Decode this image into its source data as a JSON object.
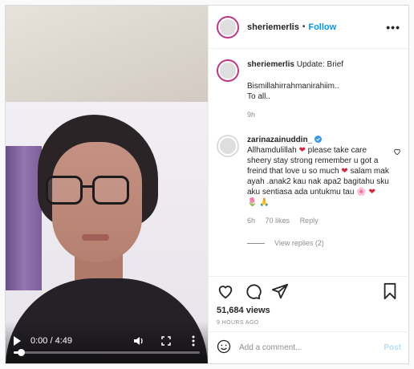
{
  "video": {
    "time": "0:00 / 4:49",
    "progress": 0.04
  },
  "header": {
    "username": "sheriemerlis",
    "separator": "•",
    "follow": "Follow",
    "more": "•••"
  },
  "caption": {
    "username": "sheriemerlis",
    "text": "Update: Brief",
    "line2": "Bismillahirrahmanirahiim..",
    "line3": "To all..",
    "time": "9h"
  },
  "comment": {
    "username": "zarinazainuddin_",
    "verified": true,
    "text_part1": "Allhamdulillah",
    "text_part2": "please take care sheery stay strong remember u got a freind that love u so much",
    "text_part3": "salam mak ayah .anak2 kau nak apa2 bagitahu sku aku sentiasa ada untukmu tau",
    "emoji_line": "🌷 🙏",
    "time": "6h",
    "likes": "70 likes",
    "reply": "Reply",
    "view_replies": "View replies (2)"
  },
  "stats": {
    "views": "51,684 views",
    "ago": "9 HOURS AGO"
  },
  "add_comment": {
    "placeholder": "Add a comment...",
    "post": "Post"
  },
  "colors": {
    "accent": "#0095f6",
    "post_disabled": "#b2dffc",
    "heart": "#d7263d",
    "avatar_ring": "#c13584"
  }
}
